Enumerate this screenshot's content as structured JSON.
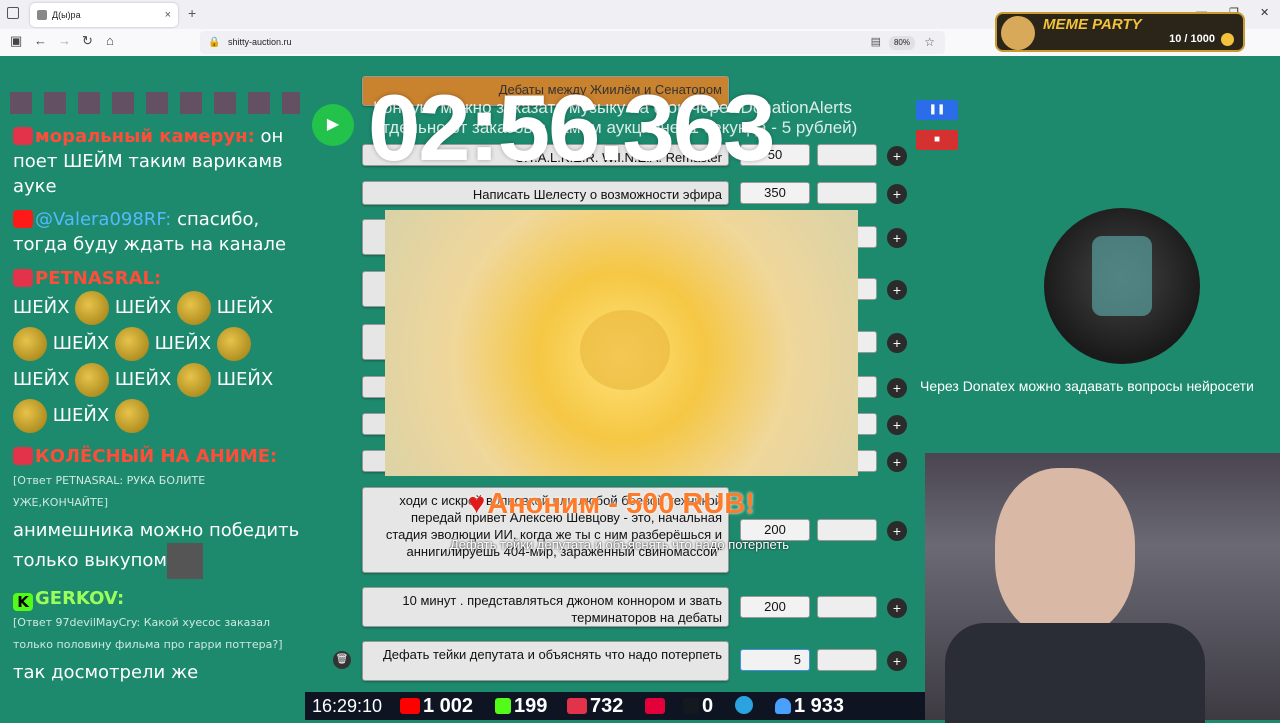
{
  "browser": {
    "tab_title": "Д(ы)ра",
    "tab_close": "×",
    "new_tab": "+",
    "url": "shitty-auction.ru",
    "zoom": "80%",
    "back": "←",
    "forward": "→",
    "reload": "↻",
    "home": "⌂",
    "minimize": "—",
    "maximize": "❐",
    "close": "✕",
    "menu": "⌄"
  },
  "meme_widget": {
    "title": "MEME PARTY",
    "count": "10 / 1000"
  },
  "chat": {
    "messages": [
      {
        "nick": "моральный камерун:",
        "text": "он поет ШЕЙМ таким варикамв ауке"
      },
      {
        "nick": "@Valera098RF:",
        "text": "спасибо, тогда буду ждать на канале"
      },
      {
        "nick": "PETNASRAL:",
        "emote_word": "ШЕЙХ"
      },
      {
        "nick": "КОЛЁСНЫЙ НА АНИМЕ:",
        "reply": "[Ответ PETNASRAL: РУКА БОЛИТЕ УЖЕ,КОНЧАЙТЕ]",
        "text": "анимешника можно победить только выкупом"
      },
      {
        "nick": "GERKOV:",
        "reply": "[Ответ 97devilMayCry: Какой хуесос заказал только половину фильма про гарри поттера?]",
        "text": "так досмотрели же"
      }
    ]
  },
  "timer": "02:56.363",
  "overlay_text": {
    "line1": "Конаукс можно заказать музыку на фон через DonationAlerts",
    "line2": "отдельно от заказов в самом аукционе (1 секунда - 5 рублей)"
  },
  "controls": {
    "pause": "❚❚",
    "stop": "■",
    "play": "▶"
  },
  "lots": [
    {
      "title": "Дебаты между Жиилём и Сенатором",
      "amount": ""
    },
    {
      "title": "S.T.A.L.K.E.R. W.I.N.E.A. Remaster",
      "amount": "50"
    },
    {
      "title": "Написать Шелесту о возможности эфира",
      "amount": "350"
    },
    {
      "title": "",
      "amount": ""
    },
    {
      "title": "",
      "amount": ""
    },
    {
      "title": "",
      "amount": ""
    },
    {
      "title": "",
      "amount": ""
    },
    {
      "title": "",
      "amount": ""
    },
    {
      "title": "",
      "amount": ""
    },
    {
      "title": "ходи с искрой волновкой или любой боевой техникой передай привет Алексею Шевцову - это, начальная стадия эволюции ИИ, когда же ты с ним разберёшься и аннигилируешь 404-мир, зараженный свиномассой\"",
      "amount": "200"
    },
    {
      "title": "10 минут . представляться джоном коннором и звать терминаторов на дебаты",
      "amount": "200"
    },
    {
      "title": "Дефать тейки депутата и объяснять что надо потерпеть",
      "amount": "5"
    }
  ],
  "plus_label": "+",
  "trash_label": "🗑",
  "donation": {
    "heart": "♥",
    "text": "Аноним - 500 RUB!",
    "message": "Дефать тейки депутата и объяснять что надо потерпеть"
  },
  "donatex_text": "Через Donatex можно задавать вопросы нейросети",
  "status_bar": {
    "time": "16:29:10",
    "youtube": "1 002",
    "kick": "199",
    "vk": "732",
    "other": "",
    "rutube": "0",
    "telegram": "",
    "viewers": "1 933"
  },
  "colors": {
    "background": "#1d8a6e",
    "accent_red": "#ff4d3a",
    "donation_orange": "#ff7a2a"
  }
}
